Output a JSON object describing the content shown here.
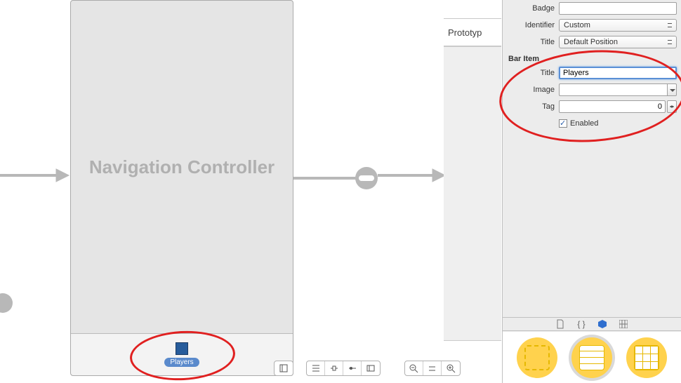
{
  "canvas": {
    "nav_controller_title": "Navigation Controller",
    "tab_bar_item_label": "Players",
    "prototype_label": "Prototyp"
  },
  "inspector": {
    "badge_label": "Badge",
    "badge_value": "",
    "identifier_label": "Identifier",
    "identifier_value": "Custom",
    "title_position_label": "Title",
    "title_position_value": "Default Position",
    "bar_item_section": "Bar Item",
    "title_label": "Title",
    "title_value": "Players",
    "image_label": "Image",
    "image_value": "",
    "tag_label": "Tag",
    "tag_value": "0",
    "enabled_label": "Enabled"
  },
  "library_tabs": [
    "file",
    "braces",
    "cube",
    "grid"
  ],
  "library_items": [
    "view",
    "tableview",
    "collectionview"
  ]
}
